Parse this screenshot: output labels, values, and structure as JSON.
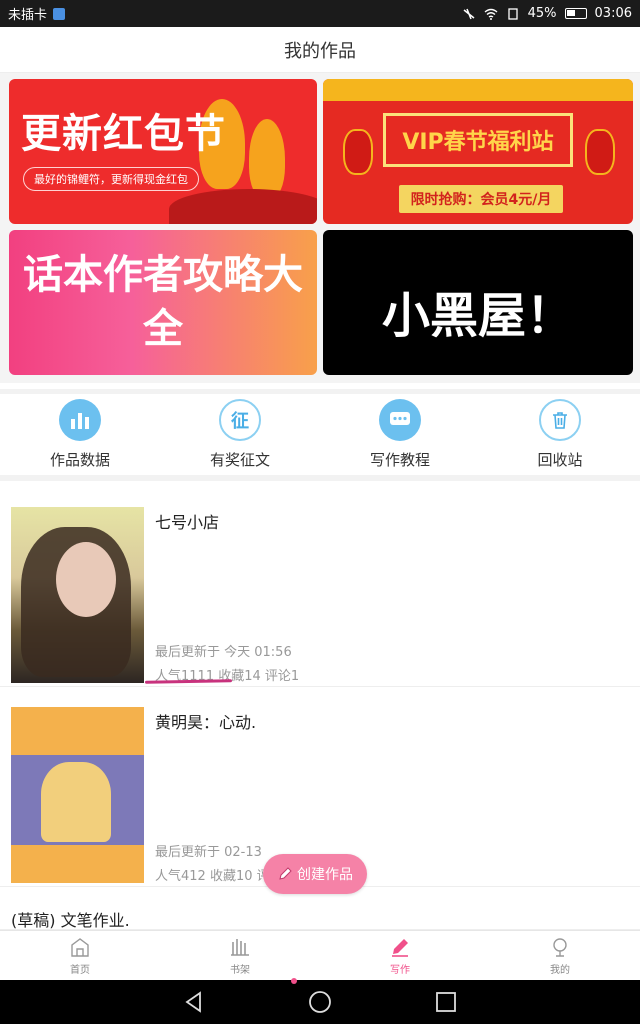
{
  "status_bar": {
    "carrier": "未插卡",
    "battery": "45%",
    "time": "03:06"
  },
  "header": {
    "title": "我的作品"
  },
  "banners": {
    "b1_title": "更新红包节",
    "b1_sub": "最好的锦鲤符，更新得现金红包",
    "b2_title": "VIP春节福利站",
    "b2_sub": "限时抢购：会员4元/月",
    "b3_title": "话本作者攻略大全",
    "b4_title": "小黑屋！"
  },
  "actions": [
    {
      "label": "作品数据",
      "icon": "bar-chart-icon"
    },
    {
      "label": "有奖征文",
      "icon": "contest-icon",
      "glyph": "征"
    },
    {
      "label": "写作教程",
      "icon": "chat-bubble-icon"
    },
    {
      "label": "回收站",
      "icon": "trash-icon"
    }
  ],
  "works": [
    {
      "name": "七号小店",
      "updated": "最后更新于 今天 01:56",
      "stats": "人气1111 收藏14 评论1"
    },
    {
      "name": "黄明昊：心动.",
      "updated": "最后更新于 02-13",
      "stats": "人气412 收藏10 评"
    },
    {
      "name": "(草稿) 文笔作业."
    }
  ],
  "create_button": {
    "label": "创建作品"
  },
  "tabs": [
    {
      "label": "首页",
      "icon": "home-icon"
    },
    {
      "label": "书架",
      "icon": "bookshelf-icon"
    },
    {
      "label": "写作",
      "icon": "pen-icon",
      "active": true
    },
    {
      "label": "我的",
      "icon": "profile-icon"
    }
  ],
  "colors": {
    "accent": "#f0508a",
    "action_icon": "#6cc0ef"
  }
}
